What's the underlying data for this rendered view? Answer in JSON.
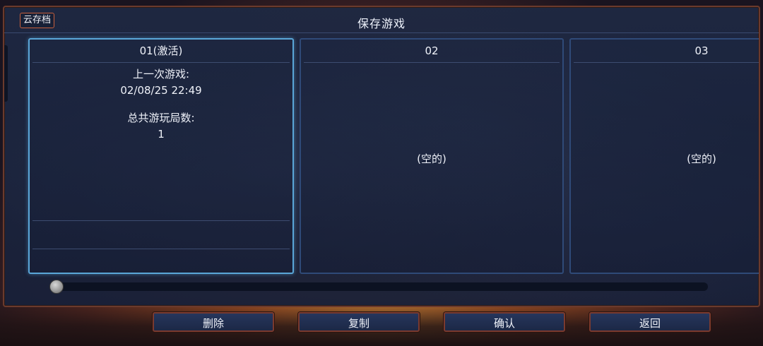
{
  "header": {
    "title": "保存游戏",
    "cloud_label": "云存档"
  },
  "slots": [
    {
      "label": "01(激活)",
      "active": true,
      "last_played_label": "上一次游戏:",
      "last_played_value": "02/08/25 22:49",
      "total_games_label": "总共游玩局数:",
      "total_games_value": "1"
    },
    {
      "label": "02",
      "active": false,
      "empty_text": "(空的)"
    },
    {
      "label": "03",
      "active": false,
      "empty_text": "(空的)"
    }
  ],
  "scrollbar": {
    "position": 0
  },
  "buttons": {
    "delete": "删除",
    "copy": "复制",
    "confirm": "确认",
    "back": "返回"
  },
  "colors": {
    "active_border": "#5aa6d8",
    "slot_border": "#2f4a78",
    "button_border": "#7a3a2e",
    "panel_bg": "#1e2842"
  }
}
